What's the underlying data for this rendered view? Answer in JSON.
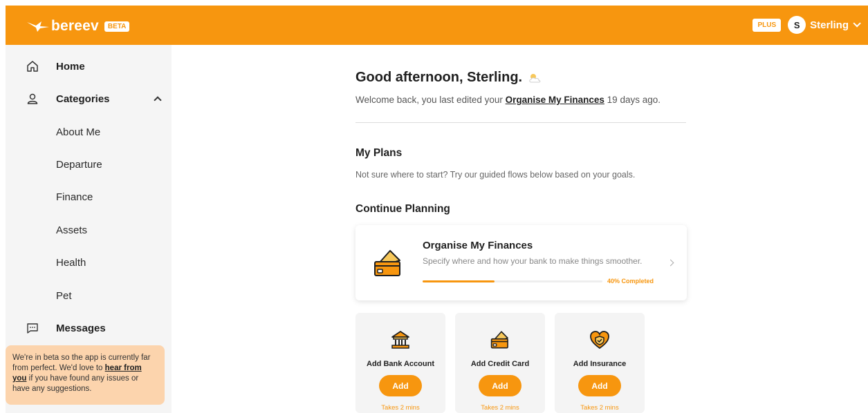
{
  "header": {
    "logo_text": "bereev",
    "beta_label": "BETA",
    "plus_label": "PLUS",
    "avatar_initial": "S",
    "user_name": "Sterling"
  },
  "sidebar": {
    "items": [
      {
        "label": "Home",
        "icon": "home-icon"
      },
      {
        "label": "Categories",
        "icon": "person-icon"
      },
      {
        "label": "About Me"
      },
      {
        "label": "Departure"
      },
      {
        "label": "Finance"
      },
      {
        "label": "Assets"
      },
      {
        "label": "Health"
      },
      {
        "label": "Pet"
      },
      {
        "label": "Messages",
        "icon": "message-icon"
      }
    ],
    "beta_note": {
      "before": "We're in beta so the app is currently far from perfect. We'd love to ",
      "link": "hear from you",
      "after": " if you have found any issues or have any suggestions."
    }
  },
  "main": {
    "greeting": "Good afternoon, Sterling.",
    "welcome": {
      "before": "Welcome back, you last edited your ",
      "link": "Organise My Finances",
      "after": " 19 days ago."
    },
    "my_plans_title": "My Plans",
    "my_plans_desc": "Not sure where to start? Try our guided flows below based on your goals.",
    "continue_title": "Continue Planning"
  },
  "plan_card": {
    "title": "Organise My Finances",
    "description": "Specify where and how your bank to make things smoother.",
    "progress_percent": 40,
    "progress_text": "40% Completed"
  },
  "quick_actions": [
    {
      "label": "Add Bank Account",
      "button": "Add",
      "time": "Takes 2 mins",
      "icon": "bank-icon"
    },
    {
      "label": "Add Credit Card",
      "button": "Add",
      "time": "Takes 2 mins",
      "icon": "credit-card-icon"
    },
    {
      "label": "Add Insurance",
      "button": "Add",
      "time": "Takes 2 mins",
      "icon": "insurance-heart-icon"
    }
  ],
  "colors": {
    "brand": "#f7960f",
    "sidebar_bg": "#f5f5f5",
    "beta_note_bg": "#fcd4ad",
    "quick_card_bg": "#f4f4f4"
  }
}
